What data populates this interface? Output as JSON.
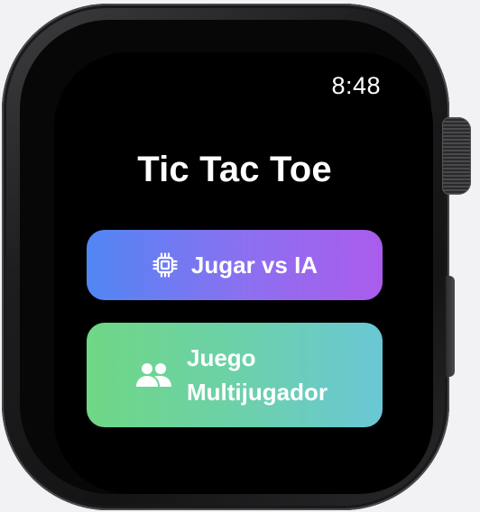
{
  "status_bar": {
    "time": "8:48"
  },
  "app": {
    "title": "Tic Tac Toe"
  },
  "menu": {
    "play_ai": {
      "label": "Jugar vs IA",
      "icon": "cpu-chip-icon",
      "gradient": [
        "#5186f3",
        "#aa5cec"
      ]
    },
    "multiplayer": {
      "label_line1": "Juego",
      "label_line2": "Multijugador",
      "icon": "two-people-icon",
      "gradient": [
        "#6fd785",
        "#6ac7d5"
      ]
    }
  },
  "device": {
    "crown_icon": "digital-crown",
    "side_button_icon": "side-button"
  }
}
